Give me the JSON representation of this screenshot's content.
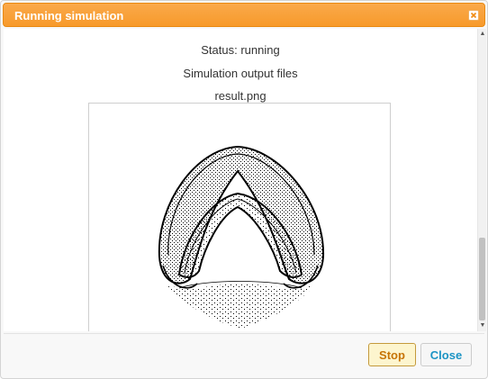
{
  "dialog": {
    "title": "Running simulation",
    "close_icon": "close-icon"
  },
  "content": {
    "status": "Status: running",
    "output_heading": "Simulation output files",
    "file_name": "result.png",
    "image_description_icon": "simulation-result-image"
  },
  "buttons": {
    "stop_label": "Stop",
    "close_label": "Close"
  },
  "colors": {
    "titlebar": "#f79a2b",
    "stop_text": "#c77405",
    "close_text": "#1c94c4"
  }
}
